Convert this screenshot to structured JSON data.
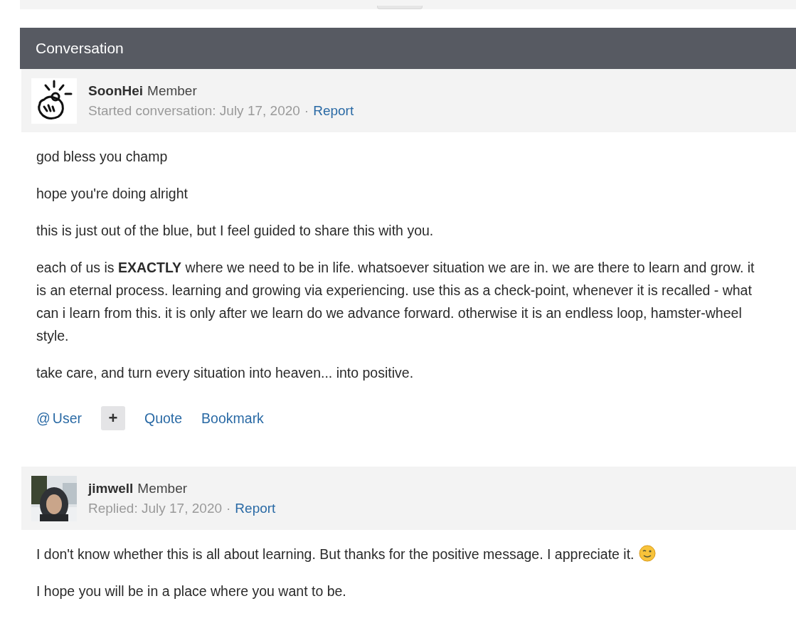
{
  "header": {
    "title": "Conversation"
  },
  "messages": [
    {
      "author": "SoonHei",
      "role": "Member",
      "meta": "Started conversation: July 17, 2020",
      "separator": "·",
      "report": "Report",
      "avatar": {
        "kind": "drawing"
      },
      "paragraphs": [
        {
          "text": "god bless you champ"
        },
        {
          "text": "hope you're doing alright"
        },
        {
          "text": "this is just out of the blue, but I feel guided to share this with you."
        },
        {
          "text": "each of us is **EXACTLY** where we need to be in life. whatsoever situation we are in. we are there to learn and grow. it is an eternal process. learning and growing via experiencing. use this as a check-point, whenever it is recalled - what can i learn from this. it is only after we learn do we advance forward. otherwise it is an endless loop, hamster-wheel style."
        },
        {
          "text": "take care, and turn every situation into heaven... into positive."
        }
      ],
      "actions": [
        {
          "kind": "mention",
          "symbol": "@",
          "label": "User"
        },
        {
          "kind": "more",
          "label": "+"
        },
        {
          "kind": "link",
          "label": "Quote"
        },
        {
          "kind": "link",
          "label": "Bookmark"
        }
      ]
    },
    {
      "author": "jimwell",
      "role": "Member",
      "meta": "Replied: July 17, 2020",
      "separator": "·",
      "report": "Report",
      "paragraphs": [
        {
          "text": "I don't know whether this is all about  learning. But thanks for the positive message. I appreciate it.",
          "emoji": true
        },
        {
          "text": "I hope you will be in a place where you want to be."
        }
      ]
    }
  ]
}
